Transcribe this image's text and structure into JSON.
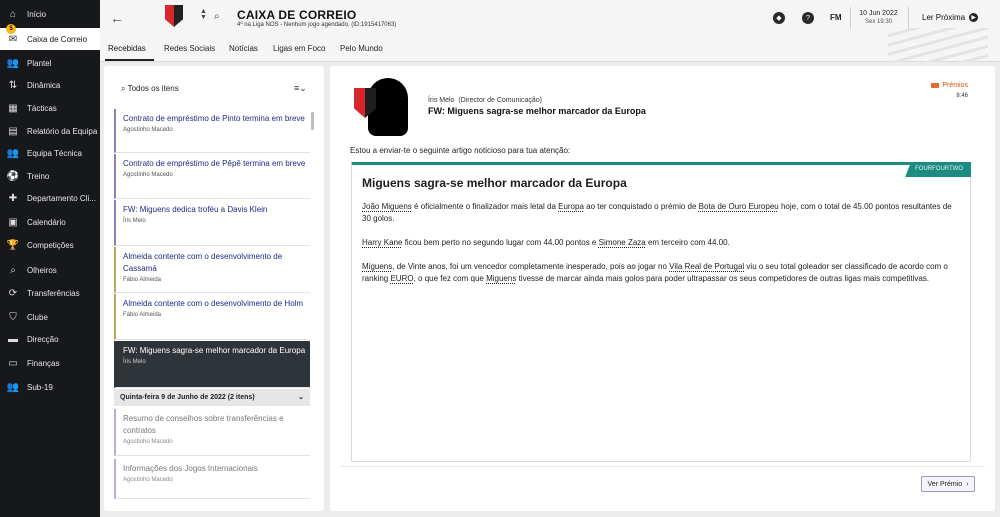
{
  "sidebar": {
    "items": [
      {
        "label": "Início",
        "icon": "home-icon",
        "glyph": "⌂"
      },
      {
        "label": "Caixa de Correio",
        "icon": "envelope-icon",
        "glyph": "✉",
        "badge": "5",
        "active": true
      },
      {
        "label": "Plantel",
        "icon": "squad-icon",
        "glyph": "👥"
      },
      {
        "label": "Dinâmica",
        "icon": "dynamics-icon",
        "glyph": "⇅"
      },
      {
        "label": "Tácticas",
        "icon": "tactics-icon",
        "glyph": "▦"
      },
      {
        "label": "Relatório da Equipa",
        "icon": "report-icon",
        "glyph": "▤"
      },
      {
        "label": "Equipa Técnica",
        "icon": "staff-icon",
        "glyph": "👥"
      },
      {
        "label": "Treino",
        "icon": "training-icon",
        "glyph": "⚽"
      },
      {
        "label": "Departamento Cli...",
        "icon": "medical-icon",
        "glyph": "✚"
      },
      {
        "label": "Calendário",
        "icon": "calendar-icon",
        "glyph": "▣"
      },
      {
        "label": "Competições",
        "icon": "trophy-icon",
        "glyph": "🏆"
      },
      {
        "label": "Olheiros",
        "icon": "scouting-icon",
        "glyph": "⌕"
      },
      {
        "label": "Transferências",
        "icon": "transfers-icon",
        "glyph": "⟳"
      },
      {
        "label": "Clube",
        "icon": "club-icon",
        "glyph": "⛉"
      },
      {
        "label": "Direcção",
        "icon": "board-icon",
        "glyph": "▬"
      },
      {
        "label": "Finanças",
        "icon": "finances-icon",
        "glyph": "▭"
      },
      {
        "label": "Sub-19",
        "icon": "youth-icon",
        "glyph": "👥"
      }
    ]
  },
  "header": {
    "title": "CAIXA DE CORREIO",
    "subtitle": "4º na Liga NOS - Nenhum jogo agendado. (ID:1915417063)",
    "tabs": [
      "Recebidas",
      "Redes Sociais",
      "Notícias",
      "Ligas em Foco",
      "Pelo Mundo"
    ],
    "date": "10 Jun 2022",
    "date_sub": "Sex 19:30",
    "fm_label": "FM",
    "continue_label": "Ler Próxima",
    "help_glyph": "?"
  },
  "inbox": {
    "filter_label": "Todos os itens",
    "messages": [
      {
        "subject": "Contrato de empréstimo de Pinto termina em breve",
        "from": "Agostinho Macedo",
        "accent": "#8c7fc3"
      },
      {
        "subject": "Contrato de empréstimo de Pêpê termina em breve",
        "from": "Agostinho Macedo",
        "accent": "#8c7fc3"
      },
      {
        "subject": "FW: Miguens dedica troféu a Davis Klein",
        "from": "Íris Melo",
        "accent": "#8c7fc3"
      },
      {
        "subject": "Almeida contente com o desenvolvimento de Cassamá",
        "from": "Fábio Almeida",
        "accent": "#c0a35a"
      },
      {
        "subject": "Almeida contente com o desenvolvimento de Holm",
        "from": "Fábio Almeida",
        "accent": "#c0a35a"
      },
      {
        "subject": "FW: Miguens sagra-se melhor marcador da Europa",
        "from": "Íris Melo",
        "accent": "#2f3439"
      }
    ],
    "day_header": "Quinta-feira 9 de Junho de 2022 (2 itens)",
    "older_messages": [
      {
        "subject": "Resumo de conselhos sobre transferências e contratos",
        "from": "Agostinho Macedo",
        "accent": "#aeb0e0"
      },
      {
        "subject": "Informações dos Jogos Internacionais",
        "from": "Agostinho Macedo",
        "accent": "#aeb0e0"
      }
    ]
  },
  "reader": {
    "sender": "Íris Melo",
    "sender_role": "(Director de Comunicação)",
    "subject": "FW: Miguens sagra-se melhor marcador da Europa",
    "tag": "Prémios",
    "time": "8:46",
    "intro": "Estou a enviar-te o seguinte artigo noticioso para tua atenção:",
    "source": "FOURFOURTWO",
    "headline": "Miguens sagra-se melhor marcador da Europa",
    "p1": {
      "a": "João Miguens",
      "b": " é oficialmente o finalizador mais letal da ",
      "c": "Europa",
      "d": " ao ter conquistado o prémio de ",
      "e": "Bota de Ouro Europeu",
      "f": " hoje, com o total de 45.00 pontos resultantes de 30 golos."
    },
    "p2": {
      "a": "Harry Kane",
      "b": " ficou bem perto no segundo lugar com 44.00 pontos e ",
      "c": "Simone Zaza",
      "d": " em terceiro com 44.00."
    },
    "p3": {
      "a": "Miguens",
      "b": ", de Vinte anos, foi um vencedor completamente inesperado, pois ao jogar no ",
      "c": "Vila Real de Portugal",
      "d": " viu o seu total goleador ser classificado de acordo com o ranking ",
      "e": "EURO",
      "f": ", o que fez com que ",
      "g": "Miguens",
      "h": " tivesse de marcar ainda mais golos para poder ultrapassar os seus competidores de outras ligas mais competitivas."
    },
    "action_label": "Ver Prémio"
  }
}
